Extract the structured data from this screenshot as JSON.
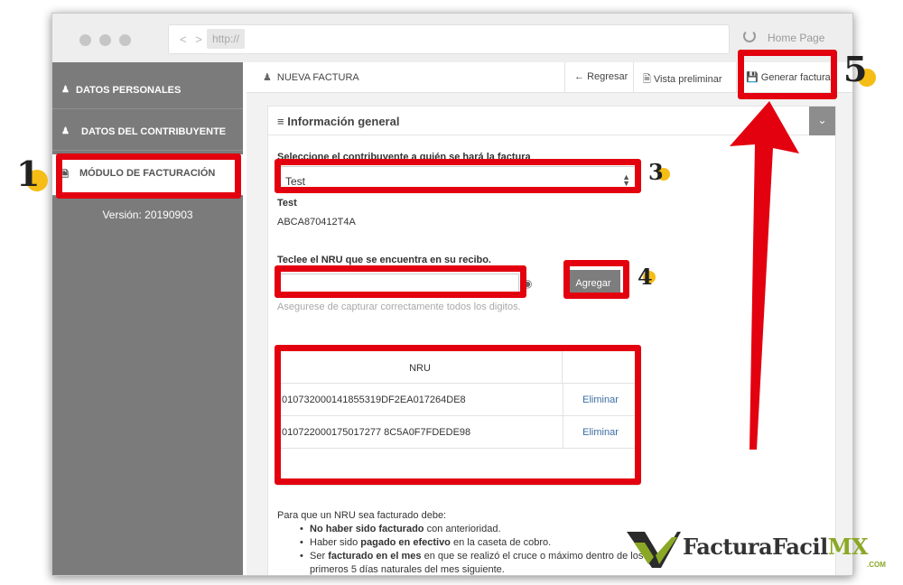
{
  "browser": {
    "nav_arrows": "< >",
    "protocol": "http://",
    "home_label": "Home Page"
  },
  "sidebar": {
    "items": [
      {
        "icon": "person-icon",
        "label": "DATOS PERSONALES"
      },
      {
        "icon": "users-icon",
        "label": "DATOS DEL CONTRIBUYENTE"
      },
      {
        "icon": "document-icon",
        "label": "MÓDULO DE FACTURACIÓN",
        "active": true
      }
    ],
    "version": "Versión: 20190903"
  },
  "toolbar": {
    "title": "NUEVA FACTURA",
    "back_label": "Regresar",
    "preview_label": "Vista preliminar",
    "generate_label": "Generar factura"
  },
  "panel": {
    "title": "Información general",
    "select_label": "Seleccione el contribuyente a quién se hará la factura",
    "selected_value": "Test",
    "taxpayer_name": "Test",
    "taxpayer_rfc": "ABCA870412T4A",
    "nru_label": "Teclee el NRU que se encuentra en su recibo.",
    "nru_value": "",
    "add_button": "Agregar",
    "hint": "Asegurese de capturar correctamente todos los digitos.",
    "table": {
      "header": "NRU",
      "rows": [
        {
          "nru": "010732000141855319DF2EA017264DE8",
          "action": "Eliminar"
        },
        {
          "nru": "010722000175017277 8C5A0F7FDEDE98",
          "action": "Eliminar"
        }
      ]
    },
    "rules": {
      "intro": "Para que un NRU sea facturado debe:",
      "r1_bold": "No haber sido facturado",
      "r1_rest": " con anterioridad.",
      "r2_pre": "Haber sido ",
      "r2_bold": "pagado en efectivo",
      "r2_rest": " en la caseta de cobro.",
      "r3_pre": "Ser ",
      "r3_bold": "facturado en el mes",
      "r3_rest": " en que se realizó el cruce o máximo dentro de los primeros 5 días naturales del mes siguiente."
    }
  },
  "annotations": {
    "n1": "1",
    "n3": "3",
    "n4": "4",
    "n5": "5",
    "color": "#e3000f",
    "dot_color": "#f5bd16"
  },
  "logo": {
    "text_main": "FacturaFacil",
    "text_mx": "MX",
    "text_com": ".COM"
  }
}
